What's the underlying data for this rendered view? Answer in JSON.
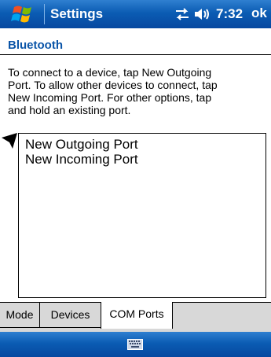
{
  "taskbar": {
    "title": "Settings",
    "time": "7:32",
    "ok_label": "ok",
    "icons": [
      "windows-flag-icon",
      "connectivity-icon",
      "volume-icon"
    ]
  },
  "header": {
    "label": "Bluetooth"
  },
  "instructions": {
    "line1": "To connect to a device, tap New Outgoing",
    "line2": "Port. To allow other devices to connect, tap",
    "line3": "New Incoming Port. For other options, tap",
    "line4": "and hold an existing port."
  },
  "ports": {
    "items": [
      {
        "label": "New Outgoing Port"
      },
      {
        "label": "New Incoming Port"
      }
    ]
  },
  "tabs": [
    {
      "label": "Mode",
      "active": false
    },
    {
      "label": "Devices",
      "active": false
    },
    {
      "label": "COM Ports",
      "active": true
    }
  ],
  "bottom_bar": {
    "icon": "keyboard-icon"
  },
  "colors": {
    "taskbar_blue": "#0b5cb3",
    "header_text": "#0b55a8",
    "tab_background": "#d8d8d8"
  }
}
